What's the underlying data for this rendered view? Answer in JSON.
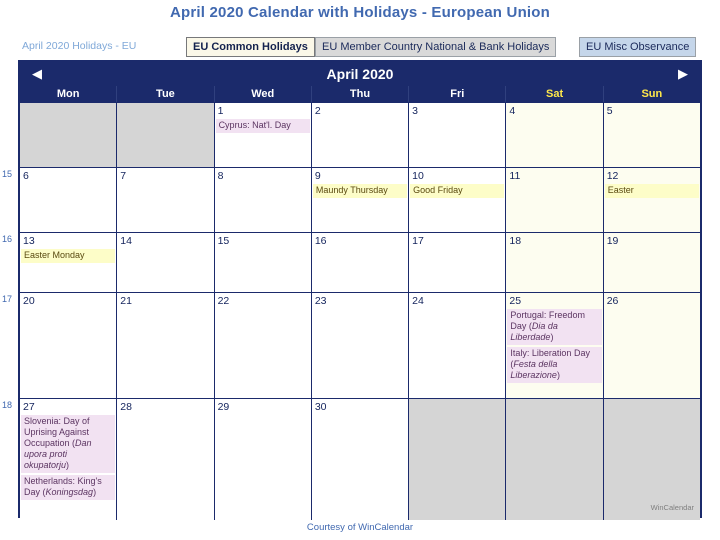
{
  "page": {
    "title": "April 2020 Calendar with Holidays - European Union",
    "breadcrumb": "April 2020 Holidays - EU",
    "footer_prefix": "Courtesy of ",
    "footer_link": "WinCalendar",
    "watermark": "WinCalendar"
  },
  "tabs": [
    {
      "label": "EU Common Holidays",
      "state": "active"
    },
    {
      "label": "EU Member Country National & Bank Holidays",
      "state": "inactive"
    },
    {
      "label": "EU Misc Observance",
      "state": "misc"
    }
  ],
  "calendar": {
    "month_label": "April 2020",
    "prev_icon": "left-arrow-icon",
    "next_icon": "right-arrow-icon",
    "day_headers": [
      "Mon",
      "Tue",
      "Wed",
      "Thu",
      "Fri",
      "Sat",
      "Sun"
    ],
    "week_numbers": [
      "",
      "15",
      "16",
      "17",
      "18"
    ],
    "weeks": [
      {
        "number": "",
        "days": [
          {
            "num": "",
            "blank": true
          },
          {
            "num": "",
            "blank": true
          },
          {
            "num": "1",
            "events": [
              {
                "text": "Cyprus: Nat'l. Day",
                "type": "national"
              }
            ]
          },
          {
            "num": "2",
            "events": []
          },
          {
            "num": "3",
            "events": []
          },
          {
            "num": "4",
            "weekend": true,
            "events": []
          },
          {
            "num": "5",
            "weekend": true,
            "events": []
          }
        ]
      },
      {
        "number": "15",
        "days": [
          {
            "num": "6",
            "events": []
          },
          {
            "num": "7",
            "events": []
          },
          {
            "num": "8",
            "events": []
          },
          {
            "num": "9",
            "events": [
              {
                "text": "Maundy Thursday",
                "type": "common"
              }
            ]
          },
          {
            "num": "10",
            "events": [
              {
                "text": "Good Friday",
                "type": "common"
              }
            ]
          },
          {
            "num": "11",
            "weekend": true,
            "events": []
          },
          {
            "num": "12",
            "weekend": true,
            "events": [
              {
                "text": "Easter",
                "type": "common"
              }
            ]
          }
        ]
      },
      {
        "number": "16",
        "days": [
          {
            "num": "13",
            "events": [
              {
                "text": "Easter Monday",
                "type": "common"
              }
            ]
          },
          {
            "num": "14",
            "events": []
          },
          {
            "num": "15",
            "events": []
          },
          {
            "num": "16",
            "events": []
          },
          {
            "num": "17",
            "events": []
          },
          {
            "num": "18",
            "weekend": true,
            "events": []
          },
          {
            "num": "19",
            "weekend": true,
            "events": []
          }
        ]
      },
      {
        "number": "17",
        "days": [
          {
            "num": "20",
            "events": []
          },
          {
            "num": "21",
            "events": []
          },
          {
            "num": "22",
            "events": []
          },
          {
            "num": "23",
            "events": []
          },
          {
            "num": "24",
            "events": []
          },
          {
            "num": "25",
            "weekend": true,
            "events": [
              {
                "text": "Portugal: Freedom Day (",
                "italic": "Dia da Liberdade",
                "tail": ")",
                "type": "national"
              },
              {
                "text": "Italy: Liberation Day (",
                "italic": "Festa della Liberazione",
                "tail": ")",
                "type": "national"
              }
            ]
          },
          {
            "num": "26",
            "weekend": true,
            "events": []
          }
        ]
      },
      {
        "number": "18",
        "days": [
          {
            "num": "27",
            "events": [
              {
                "text": "Slovenia: Day of Uprising Against Occupation (",
                "italic": "Dan upora proti okupatorju",
                "tail": ")",
                "type": "national"
              },
              {
                "text": "Netherlands: King's Day (",
                "italic": "Koningsdag",
                "tail": ")",
                "type": "national"
              }
            ]
          },
          {
            "num": "28",
            "events": []
          },
          {
            "num": "29",
            "events": []
          },
          {
            "num": "30",
            "events": []
          },
          {
            "num": "",
            "blank": true
          },
          {
            "num": "",
            "blank": true,
            "weekend": true
          },
          {
            "num": "",
            "blank": true,
            "weekend": true
          }
        ]
      }
    ]
  },
  "colors": {
    "frame": "#1b2a6b",
    "accent_text": "#4169b0",
    "common_holiday_bg": "#fdfdc8",
    "national_holiday_bg": "#f2e2f2",
    "weekend_bg": "#fdfdf0",
    "blank_bg": "#d5d5d5"
  }
}
